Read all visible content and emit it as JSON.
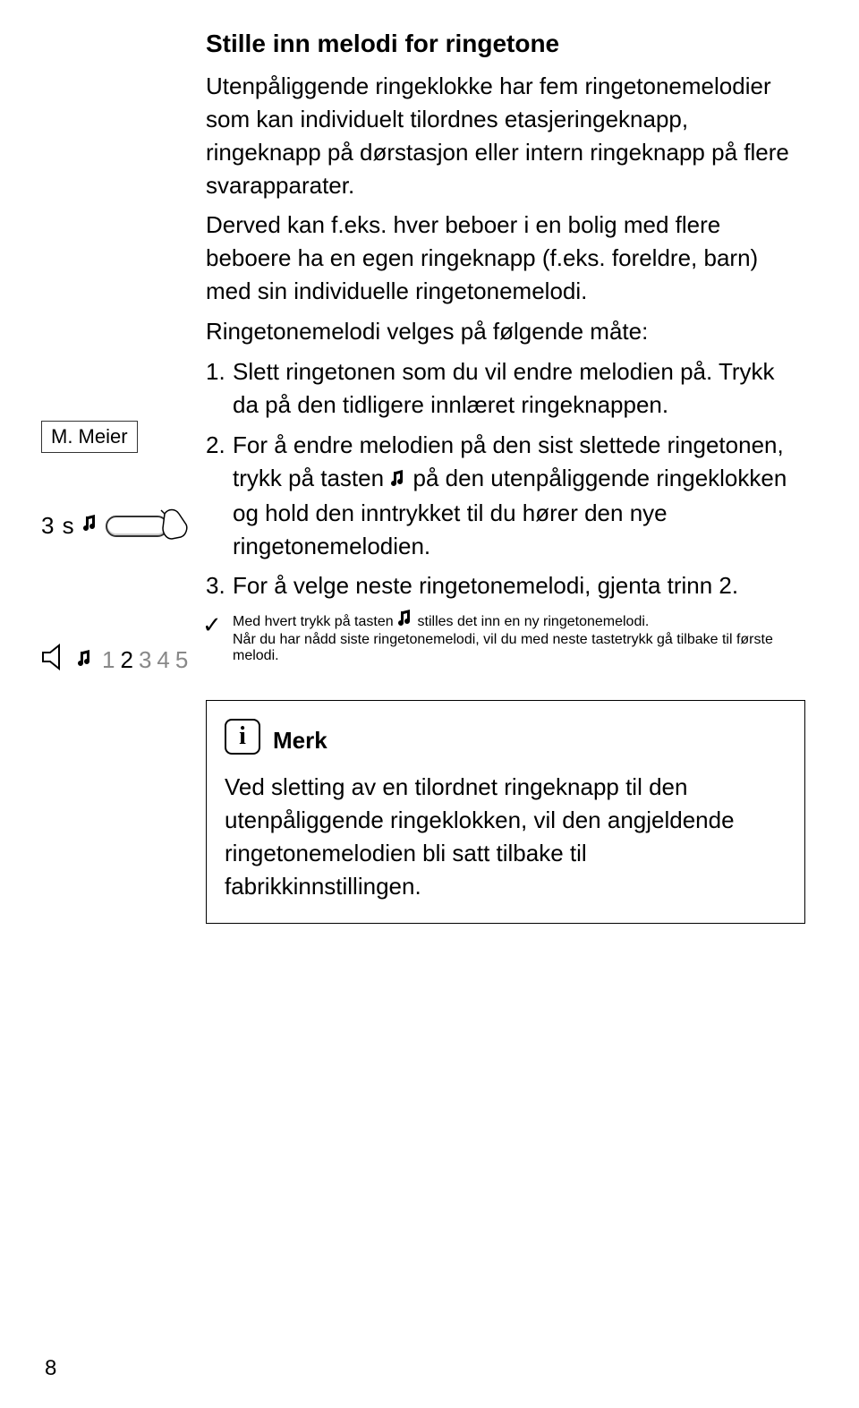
{
  "title": "Stille inn melodi for ringetone",
  "intro1": "Utenpåliggende ringeklokke har fem ringetone­melodier som kan individuelt tilordnes etasjerin­geknapp, ringeknapp på dørstasjon eller intern ringeknapp på flere svarapparater.",
  "intro2": "Derved kan f.eks. hver beboer i en bolig med flere beboere ha en egen ringeknapp (f.eks. for­eldre, barn) med sin individuelle ringetoneme­lodi.",
  "intro3": "Ringetonemelodi velges på følgende måte:",
  "steps": {
    "s1": "Slett ringetonen som du vil endre melodien på. Trykk da på den tidligere innlæret ringe­knappen.",
    "s2a": "For å endre melodien på den sist slettede rin­getonen, trykk på tasten ",
    "s2b": " på den utenpålig­gende ringeklokken og hold den inntrykket til du hører den nye ringetonemelodien.",
    "s3": "For å velge neste ringetonemelodi, gjenta trinn 2."
  },
  "check": {
    "a": "Med hvert trykk på tasten ",
    "b": " stilles det inn en ny ringetonemelodi.",
    "c": "Når du har nådd siste ringetonemelodi, vil du med neste tastetrykk gå tilbake til første melodi."
  },
  "note": {
    "title": "Merk",
    "body": "Ved sletting av en tilordnet ringeknapp til den utenpåliggende ringeklokken, vil den angjel­dende ringetonemelodien bli satt tilbake til fabrikkinnstillingen."
  },
  "left": {
    "label": "M. Meier",
    "press_time": "3 s",
    "sequence": [
      "1",
      "2",
      "3",
      "4",
      "5"
    ],
    "active_index": 1
  },
  "page_number": "8"
}
